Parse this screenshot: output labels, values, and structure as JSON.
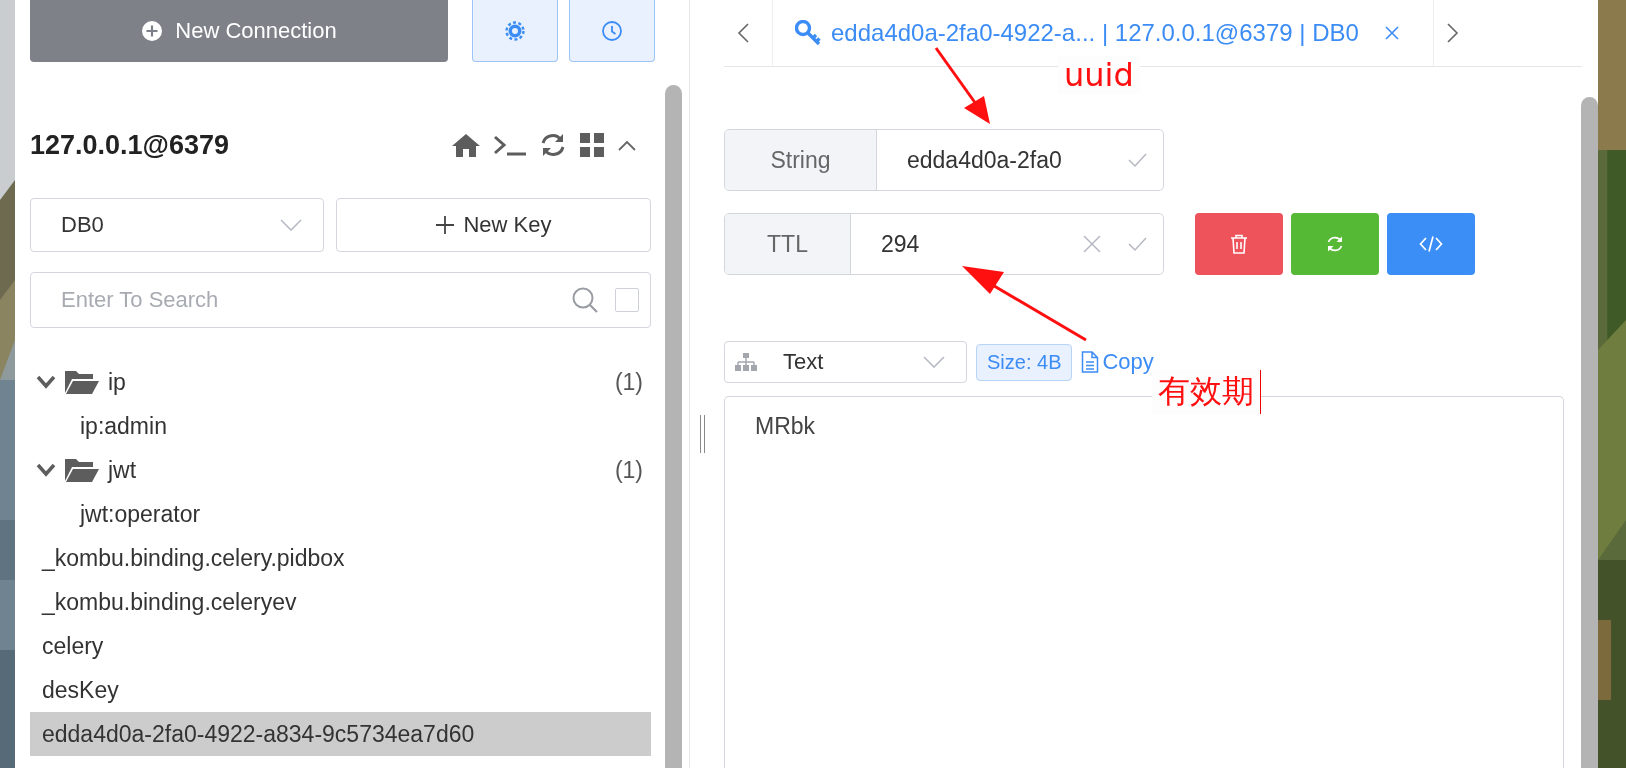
{
  "sidebar": {
    "new_connection": {
      "label": "New Connection"
    },
    "server": {
      "title": "127.0.0.1@6379",
      "expanded": true
    },
    "db_select": {
      "value": "DB0"
    },
    "new_key": {
      "label": "New Key"
    },
    "search": {
      "placeholder": "Enter To Search",
      "checked": false
    },
    "tree": [
      {
        "kind": "folder",
        "label": "ip",
        "count": "(1)",
        "expanded": true,
        "children": [
          {
            "kind": "key",
            "label": "ip:admin",
            "selected": false
          }
        ]
      },
      {
        "kind": "folder",
        "label": "jwt",
        "count": "(1)",
        "expanded": true,
        "children": [
          {
            "kind": "key",
            "label": "jwt:operator",
            "selected": false
          }
        ]
      },
      {
        "kind": "key",
        "label": "_kombu.binding.celery.pidbox",
        "selected": false
      },
      {
        "kind": "key",
        "label": "_kombu.binding.celeryev",
        "selected": false
      },
      {
        "kind": "key",
        "label": "celery",
        "selected": false
      },
      {
        "kind": "key",
        "label": "desKey",
        "selected": false
      },
      {
        "kind": "key",
        "label": "edda4d0a-2fa0-4922-a834-9c5734ea7d60",
        "selected": true
      }
    ]
  },
  "tabs": [
    {
      "title": "edda4d0a-2fa0-4922-a... | 127.0.0.1@6379 | DB0",
      "selected": true
    }
  ],
  "key": {
    "type": "String",
    "name": "edda4d0a-2fa0"
  },
  "ttl": {
    "label": "TTL",
    "value": "294"
  },
  "viewer": {
    "format": "Text",
    "size": "Size: 4B",
    "copy": "Copy",
    "content": "MRbk"
  },
  "annotations": [
    {
      "text": "uuid"
    },
    {
      "text": "有效期"
    }
  ]
}
